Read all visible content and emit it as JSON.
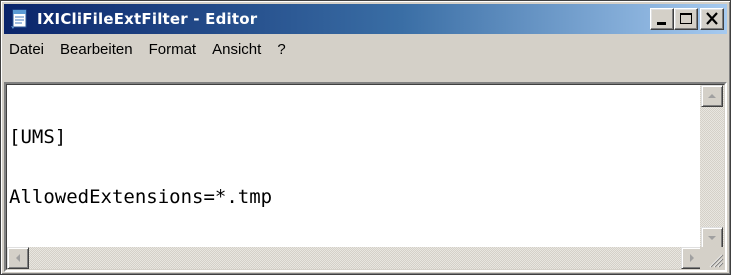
{
  "window": {
    "title": "IXICliFileExtFilter - Editor",
    "icon": "notepad-icon",
    "controls": {
      "minimize_icon": "minimize-icon",
      "maximize_icon": "maximize-icon",
      "close_icon": "close-icon"
    }
  },
  "menubar": {
    "items": [
      "Datei",
      "Bearbeiten",
      "Format",
      "Ansicht",
      "?"
    ]
  },
  "editor": {
    "lines": [
      "[UMS]",
      "AllowedExtensions=*.tmp"
    ]
  },
  "colors": {
    "titlebar_start": "#0a246a",
    "titlebar_end": "#a6caf0",
    "face": "#d4d0c8"
  }
}
